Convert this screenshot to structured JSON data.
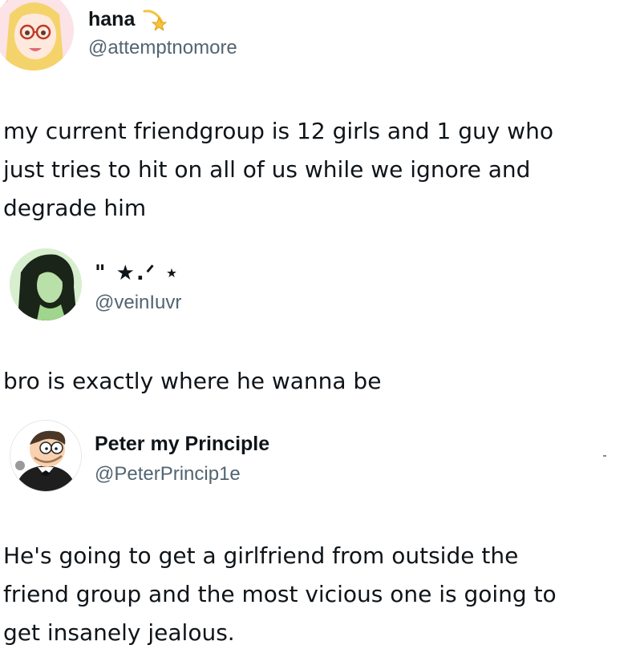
{
  "posts": [
    {
      "display_name": "hana",
      "name_emoji_icon": "shooting-star-emoji",
      "handle": "@attemptnomore",
      "avatar_icon": "anime-girl-glasses-avatar",
      "text": "my current friendgroup is 12 girls and 1 guy who\njust tries to hit on all of us while we ignore and\ndegrade him"
    },
    {
      "display_name": "\" ★.ᐟ ⋆",
      "handle": "@veinIuvr",
      "avatar_icon": "green-tinted-portrait-avatar",
      "text": "bro is exactly where he wanna be"
    },
    {
      "display_name": "Peter my Principle",
      "handle": "@PeterPrincip1e",
      "avatar_icon": "cartoon-man-tuxedo-avatar",
      "text": "He's going to get a girlfriend from outside the\nfriend group and the most vicious one is going to\nget insanely jealous."
    }
  ],
  "colors": {
    "text_primary": "#0f1419",
    "text_secondary": "#536471",
    "background": "#ffffff"
  }
}
